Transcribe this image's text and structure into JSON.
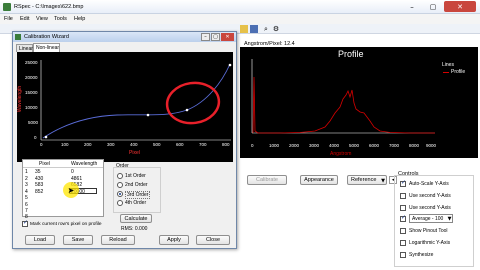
{
  "app": {
    "title": "RSpec - C:\\Images\\622.bmp",
    "menu": [
      "File",
      "Edit",
      "View",
      "Tools",
      "Help"
    ],
    "window_controls": [
      "–",
      "▢",
      "✕"
    ]
  },
  "dialog": {
    "title": "Calibration Wizard",
    "tabs": [
      "Linear",
      "Non-linear"
    ],
    "chart": {
      "ylabel": "Wavelength",
      "xlabel": "Pixel",
      "y_ticks": [
        "25000",
        "20000",
        "15000",
        "10000",
        "5000",
        "0"
      ],
      "x_ticks": [
        "0",
        "100",
        "200",
        "300",
        "400",
        "500",
        "600",
        "700",
        "800"
      ]
    },
    "table": {
      "headers": [
        "Pixel",
        "Wavelength"
      ],
      "rows": [
        {
          "n": "1",
          "pixel": "35",
          "wl": "0"
        },
        {
          "n": "2",
          "pixel": "430",
          "wl": "4861"
        },
        {
          "n": "3",
          "pixel": "583",
          "wl": "6582"
        },
        {
          "n": "4",
          "pixel": "852",
          "wl": "20000"
        },
        {
          "n": "5",
          "pixel": "",
          "wl": ""
        },
        {
          "n": "6",
          "pixel": "",
          "wl": ""
        },
        {
          "n": "7",
          "pixel": "",
          "wl": ""
        },
        {
          "n": "8",
          "pixel": "",
          "wl": ""
        }
      ]
    },
    "order": {
      "title": "Order",
      "options": [
        "1st Order",
        "2nd Order",
        "3rd Order",
        "4th Order"
      ],
      "selected_index": 2
    },
    "calculate_label": "Calculate",
    "rms_label": "RMS: 0.000",
    "mark_label": "Mark current row's pixel on profile",
    "mark_checked": true,
    "buttons": {
      "load": "Load",
      "save": "Save",
      "reload": "Reload",
      "apply": "Apply",
      "close": "Close"
    }
  },
  "profile": {
    "header": "Angstrom/Pixel: 12.4",
    "title": "Profile",
    "legend_title": "Lines",
    "legend_series": "Profile",
    "x_ticks": [
      "0",
      "1000",
      "2000",
      "3000",
      "4000",
      "5000",
      "6000",
      "7000",
      "8000",
      "9000"
    ],
    "xlabel": "Angstrom",
    "colors": {
      "series": "#d40000",
      "chart_bg": "#000000",
      "title": "#ffffff"
    }
  },
  "bottom_bar": {
    "calibrate": "Calibrate",
    "appearance": "Appearance",
    "reference": "Reference"
  },
  "controls": {
    "title": "Controls",
    "items": [
      {
        "label": "Auto-Scale Y-Axis",
        "checked": true
      },
      {
        "label": "Use second Y-Axis",
        "checked": false
      },
      {
        "label": "Use second Y-Axis",
        "checked": false
      },
      {
        "label": "Average - 100",
        "checked": true
      },
      {
        "label": "Show Pinout Tool",
        "checked": false
      },
      {
        "label": "Logarithmic Y-Axis",
        "checked": false
      },
      {
        "label": "Synthesize",
        "checked": false
      }
    ]
  }
}
